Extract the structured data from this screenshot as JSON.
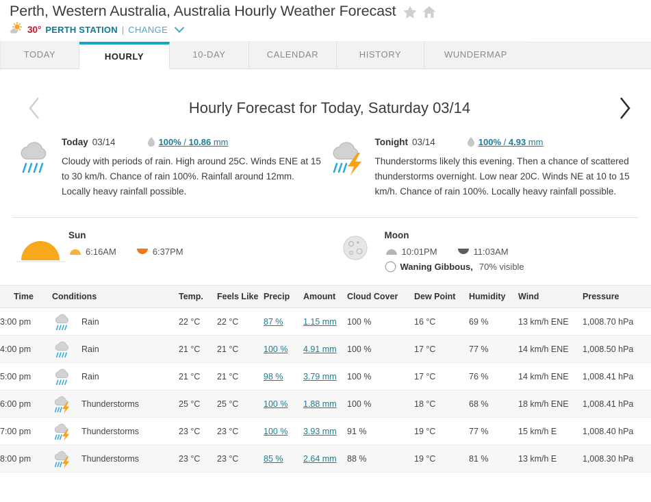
{
  "header": {
    "title": "Perth, Western Australia, Australia Hourly Weather Forecast",
    "star_icon": "star-icon",
    "home_icon": "home-icon",
    "station": {
      "condition_icon": "sun-behind-cloud-icon",
      "temperature": "30°",
      "name": "PERTH STATION",
      "separator": "|",
      "change_label": "CHANGE",
      "chevron_icon": "chevron-down-icon"
    }
  },
  "tabs": [
    {
      "label": "TODAY",
      "active": false
    },
    {
      "label": "HOURLY",
      "active": true
    },
    {
      "label": "10-DAY",
      "active": false
    },
    {
      "label": "CALENDAR",
      "active": false
    },
    {
      "label": "HISTORY",
      "active": false
    },
    {
      "label": "WUNDERMAP",
      "active": false
    }
  ],
  "forecast": {
    "prev_icon": "chevron-left-icon",
    "next_icon": "chevron-right-icon",
    "heading": "Hourly Forecast for Today, Saturday 03/14"
  },
  "periods": [
    {
      "icon": "rain-cloud-icon",
      "name": "Today",
      "date": "03/14",
      "precip_icon": "raindrop-icon",
      "precip_chance": "100%",
      "precip_sep": " / ",
      "precip_amount": "10.86",
      "precip_unit": " mm",
      "text": "Cloudy with periods of rain. High around 25C. Winds ENE at 15 to 30 km/h. Chance of rain 100%. Rainfall around 12mm. Locally heavy rainfall possible."
    },
    {
      "icon": "thunderstorm-icon",
      "name": "Tonight",
      "date": "03/14",
      "precip_icon": "raindrop-icon",
      "precip_chance": "100%",
      "precip_sep": " / ",
      "precip_amount": "4.93",
      "precip_unit": " mm",
      "text": "Thunderstorms likely this evening. Then a chance of scattered thunderstorms overnight. Low near 20C. Winds NE at 10 to 15 km/h. Chance of rain 100%. Locally heavy rainfall possible."
    }
  ],
  "astronomy": {
    "sun": {
      "icon": "sun-arc-icon",
      "title": "Sun",
      "rise_icon": "sunrise-icon",
      "rise_time": "6:16AM",
      "set_icon": "sunset-icon",
      "set_time": "6:37PM"
    },
    "moon": {
      "icon": "moon-icon",
      "title": "Moon",
      "rise_icon": "moonrise-icon",
      "rise_time": "10:01PM",
      "set_icon": "moonset-icon",
      "set_time": "11:03AM",
      "phase_icon": "moon-phase-icon",
      "phase_label": "Waning Gibbous,",
      "phase_visible": "70% visible"
    }
  },
  "table": {
    "columns": [
      "Time",
      "Conditions",
      "Temp.",
      "Feels Like",
      "Precip",
      "Amount",
      "Cloud Cover",
      "Dew Point",
      "Humidity",
      "Wind",
      "Pressure"
    ],
    "rows": [
      {
        "time": "3:00 pm",
        "icon": "rain-cloud-icon",
        "conditions": "Rain",
        "temp": "22 °C",
        "feels_like": "22 °C",
        "precip": "87 %",
        "amount": "1.15 mm",
        "cloud_cover": "100 %",
        "dew_point": "16 °C",
        "humidity": "69 %",
        "wind": "13 km/h ENE",
        "pressure": "1,008.70 hPa"
      },
      {
        "time": "4:00 pm",
        "icon": "rain-cloud-icon",
        "conditions": "Rain",
        "temp": "21 °C",
        "feels_like": "21 °C",
        "precip": "100 %",
        "amount": "4.91 mm",
        "cloud_cover": "100 %",
        "dew_point": "17 °C",
        "humidity": "77 %",
        "wind": "14 km/h ENE",
        "pressure": "1,008.50 hPa"
      },
      {
        "time": "5:00 pm",
        "icon": "rain-cloud-icon",
        "conditions": "Rain",
        "temp": "21 °C",
        "feels_like": "21 °C",
        "precip": "98 %",
        "amount": "3.79 mm",
        "cloud_cover": "100 %",
        "dew_point": "17 °C",
        "humidity": "76 %",
        "wind": "14 km/h ENE",
        "pressure": "1,008.41 hPa"
      },
      {
        "time": "6:00 pm",
        "icon": "thunderstorm-icon",
        "conditions": "Thunderstorms",
        "temp": "25 °C",
        "feels_like": "25 °C",
        "precip": "100 %",
        "amount": "1.88 mm",
        "cloud_cover": "100 %",
        "dew_point": "18 °C",
        "humidity": "68 %",
        "wind": "18 km/h ENE",
        "pressure": "1,008.41 hPa"
      },
      {
        "time": "7:00 pm",
        "icon": "thunderstorm-icon",
        "conditions": "Thunderstorms",
        "temp": "23 °C",
        "feels_like": "23 °C",
        "precip": "100 %",
        "amount": "3.93 mm",
        "cloud_cover": "91 %",
        "dew_point": "19 °C",
        "humidity": "77 %",
        "wind": "15 km/h E",
        "pressure": "1,008.40 hPa"
      },
      {
        "time": "8:00 pm",
        "icon": "thunderstorm-icon",
        "conditions": "Thunderstorms",
        "temp": "23 °C",
        "feels_like": "23 °C",
        "precip": "85 %",
        "amount": "2.64 mm",
        "cloud_cover": "88 %",
        "dew_point": "19 °C",
        "humidity": "81 %",
        "wind": "13 km/h E",
        "pressure": "1,008.30 hPa"
      }
    ]
  },
  "colors": {
    "accent_teal": "#17a2c6",
    "link_teal": "#1b7e97",
    "station_name": "#0d7b94",
    "temp_red": "#c8102e",
    "sun_orange": "#f5a623",
    "bolt_orange": "#f9a01b",
    "rain_blue": "#29abe2",
    "cloud_gray": "#cccccc",
    "row_alt": "#f7f7f7",
    "header_bg": "#f4f4f4"
  }
}
